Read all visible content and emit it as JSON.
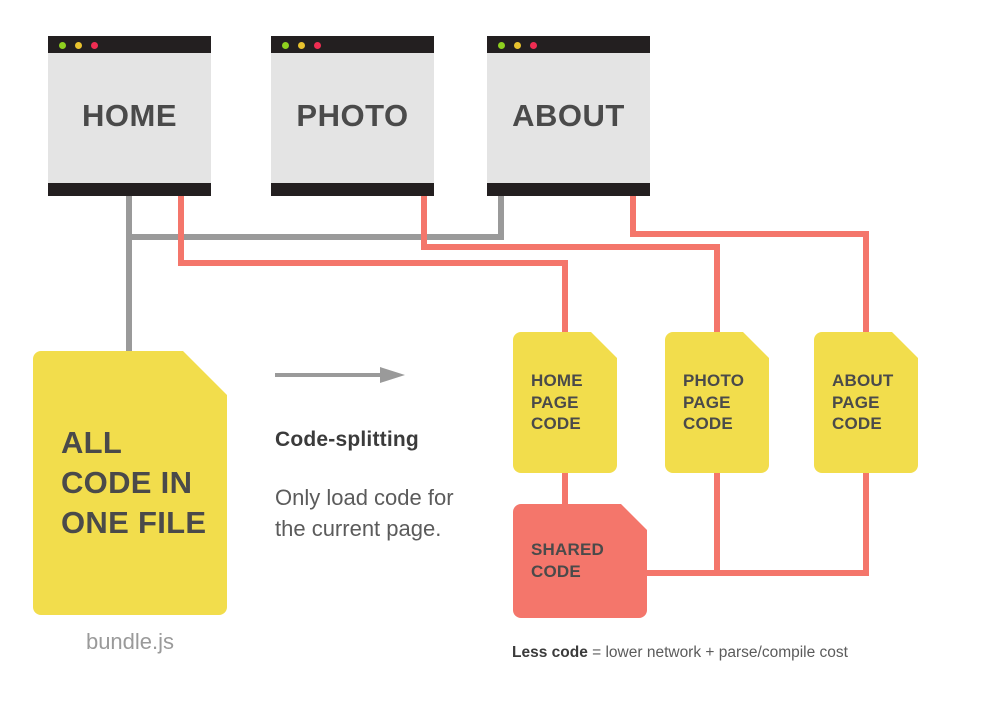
{
  "diagram": {
    "title": "Code-splitting",
    "colors": {
      "yellow": "#f2dd4c",
      "red": "#f4766b",
      "gray": "#9a9a9a",
      "dark": "#231f20",
      "screen": "#e4e4e4",
      "text": "#4a4a4a"
    }
  },
  "browsers": [
    {
      "id": "home",
      "label": "HOME",
      "dots": [
        "green-dot",
        "yellow-dot",
        "red-dot"
      ]
    },
    {
      "id": "photo",
      "label": "PHOTO",
      "dots": [
        "green-dot",
        "yellow-dot",
        "red-dot"
      ]
    },
    {
      "id": "about",
      "label": "ABOUT",
      "dots": [
        "green-dot",
        "yellow-dot",
        "red-dot"
      ]
    }
  ],
  "bundle": {
    "label": "ALL\nCODE IN\nONE FILE",
    "caption": "bundle.js"
  },
  "middle": {
    "arrow": "arrow-right-icon",
    "title": "Code-splitting",
    "description": "Only load code for the current page."
  },
  "chunks": [
    {
      "id": "home",
      "label": "HOME\nPAGE\nCODE"
    },
    {
      "id": "photo",
      "label": "PHOTO\nPAGE\nCODE"
    },
    {
      "id": "about",
      "label": "ABOUT\nPAGE\nCODE"
    }
  ],
  "shared": {
    "label": "SHARED\nCODE"
  },
  "footnote": {
    "strong": "Less code",
    "rest": " = lower network + parse/compile cost"
  }
}
